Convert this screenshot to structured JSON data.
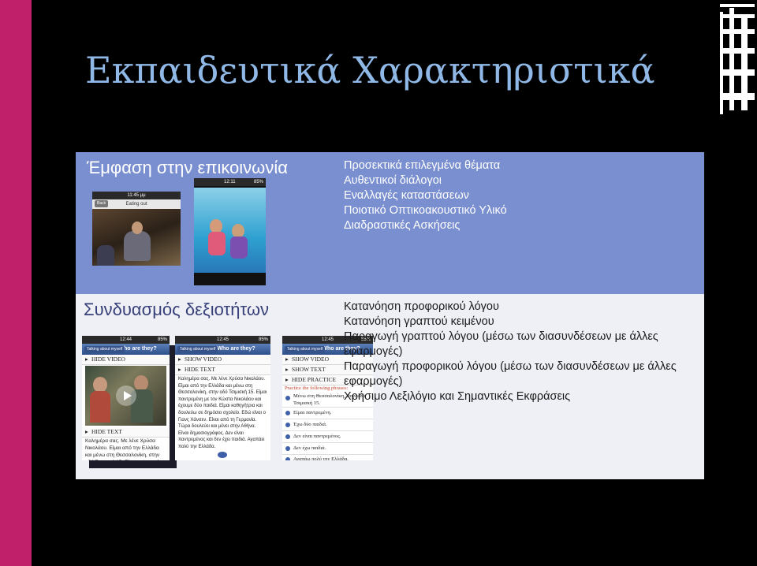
{
  "slide": {
    "title": "Εκπαιδευτικά Χαρακτηριστικά",
    "section1": {
      "heading": "Έμφαση στην επικοινωνία",
      "items": [
        "Προσεκτικά επιλεγμένα θέματα",
        "Αυθεντικοί διάλογοι",
        "Εναλλαγές καταστάσεων",
        "Ποιοτικό Οπτικοακουστικό Υλικό",
        "Διαδραστικές Ασκήσεις"
      ]
    },
    "section2": {
      "heading": "Συνδυασμός δεξιοτήτων",
      "items": [
        "Κατανόηση προφορικού λόγου",
        "Κατανόηση γραπτού κειμένου",
        "Παραγωγή γραπτού λόγου (μέσω των διασυνδέσεων με άλλες εφαρμογές)",
        "Παραγωγή προφορικού λόγου (μέσω των διασυνδέσεων με άλλες εφαρμογές)",
        "Χρήσιμο Λεξιλόγιο και Σημαντικές Εκφράσεις"
      ]
    }
  },
  "screens": {
    "s1": {
      "status": "11:45 μμ",
      "title": "Eating out",
      "back": "Back"
    },
    "s2": {
      "status": "12:11",
      "battery": "85%"
    },
    "s3": {
      "status": "12:44",
      "battery": "85%",
      "back": "Talking about myself",
      "title": "Who are they?",
      "hide_video": "HIDE VIDEO",
      "hide_text": "HIDE TEXT",
      "text": "Καλημέρα σας. Με λένε Χρύσα Νικολάου. Είμαι από την Ελλάδα και μένω στη Θεσσαλονίκη, στην οδό Τσιμισκή 15. Είμαι παντρεμένη με τον"
    },
    "s4": {
      "status": "12:45",
      "battery": "85%",
      "back": "Talking about myself",
      "title": "Who are they?",
      "show_video": "SHOW VIDEO",
      "hide_text": "HIDE TEXT",
      "text": "Καλημέρα σας. Με λένε Χρύσα Νικολάου. Είμαι από την Ελλάδα και μένω στη Θεσσαλονίκη, στην οδό Τσιμισκή 15. Είμαι παντρεμένη με τον Κώστα Νικολάου και έχουμε δύο παιδιά. Είμαι καθηγήτρια και δουλεύω σε δημόσιο σχολείο. Εδώ είναι ο Γιανς Χάνσεν. Είναι από τη Γερμανία. Τώρα δουλεύει και μένει στην Αθήνα. Είναι δημοσιογράφος. Δεν είναι παντρεμένος και δεν έχει παιδιά. Αγαπάει πολύ την Ελλάδα."
    },
    "s5": {
      "status": "12:45",
      "battery": "85%",
      "back": "Talking about myself",
      "title": "Who are they?",
      "show_video": "SHOW VIDEO",
      "show_text": "SHOW TEXT",
      "hide_practice": "HIDE PRACTICE",
      "practice_label": "Practice the following phrases:",
      "phrases": [
        "Μένω στη Θεσσαλονίκη, στην οδό Τσιμισκή 15.",
        "Είμαι παντρεμένη.",
        "Έχω δύο παιδιά.",
        "Δεν είναι παντρεμένος.",
        "Δεν έχω παιδιά.",
        "Αγαπάω πολύ την Ελλάδα."
      ]
    }
  }
}
